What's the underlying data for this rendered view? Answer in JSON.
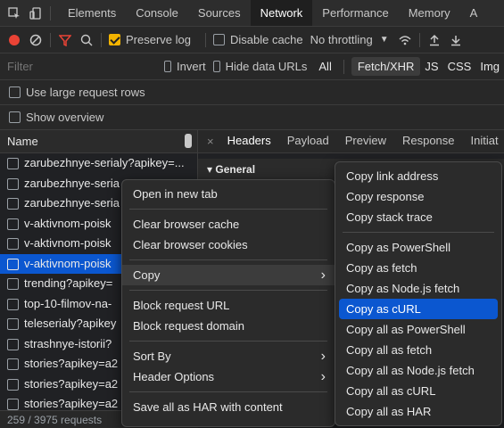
{
  "tabs": [
    "Elements",
    "Console",
    "Sources",
    "Network",
    "Performance",
    "Memory",
    "A"
  ],
  "active_tab": "Network",
  "toolbar": {
    "preserve_log": "Preserve log",
    "disable_cache": "Disable cache",
    "throttling": "No throttling"
  },
  "filter": {
    "placeholder": "Filter",
    "invert": "Invert",
    "hide_data_urls": "Hide data URLs",
    "types": [
      "All",
      "Fetch/XHR",
      "JS",
      "CSS",
      "Img"
    ],
    "active_type": "Fetch/XHR"
  },
  "options": {
    "large_rows": "Use large request rows",
    "show_overview": "Show overview"
  },
  "name_header": "Name",
  "requests": [
    "zarubezhnye-serialy?apikey=...",
    "zarubezhnye-seria",
    "zarubezhnye-seria",
    "v-aktivnom-poisk",
    "v-aktivnom-poisk",
    "v-aktivnom-poisk",
    "trending?apikey=",
    "top-10-filmov-na-",
    "teleserialy?apikey",
    "strashnye-istorii?",
    "stories?apikey=a2",
    "stories?apikey=a2",
    "stories?apikey=a2"
  ],
  "selected_request_index": 5,
  "status_text": "259 / 3975 requests",
  "detail_tabs": [
    "Headers",
    "Payload",
    "Preview",
    "Response",
    "Initiat"
  ],
  "active_detail_tab": "Headers",
  "general_label": "▾ General",
  "context_menu": {
    "items": [
      {
        "label": "Open in new tab"
      },
      {
        "sep": true
      },
      {
        "label": "Clear browser cache"
      },
      {
        "label": "Clear browser cookies"
      },
      {
        "sep": true
      },
      {
        "label": "Copy",
        "submenu": true,
        "highlighted": true
      },
      {
        "sep": true
      },
      {
        "label": "Block request URL"
      },
      {
        "label": "Block request domain"
      },
      {
        "sep": true
      },
      {
        "label": "Sort By",
        "submenu": true
      },
      {
        "label": "Header Options",
        "submenu": true
      },
      {
        "sep": true
      },
      {
        "label": "Save all as HAR with content"
      }
    ]
  },
  "copy_submenu": {
    "items": [
      {
        "label": "Copy link address"
      },
      {
        "label": "Copy response"
      },
      {
        "label": "Copy stack trace"
      },
      {
        "sep": true
      },
      {
        "label": "Copy as PowerShell"
      },
      {
        "label": "Copy as fetch"
      },
      {
        "label": "Copy as Node.js fetch"
      },
      {
        "label": "Copy as cURL",
        "selected": true
      },
      {
        "label": "Copy all as PowerShell"
      },
      {
        "label": "Copy all as fetch"
      },
      {
        "label": "Copy all as Node.js fetch"
      },
      {
        "label": "Copy all as cURL"
      },
      {
        "label": "Copy all as HAR"
      }
    ]
  },
  "colors": {
    "accent": "#0b57d0",
    "record": "#ea4335",
    "filter_icon": "#ea4335",
    "checkbox_on": "#f4b400"
  }
}
